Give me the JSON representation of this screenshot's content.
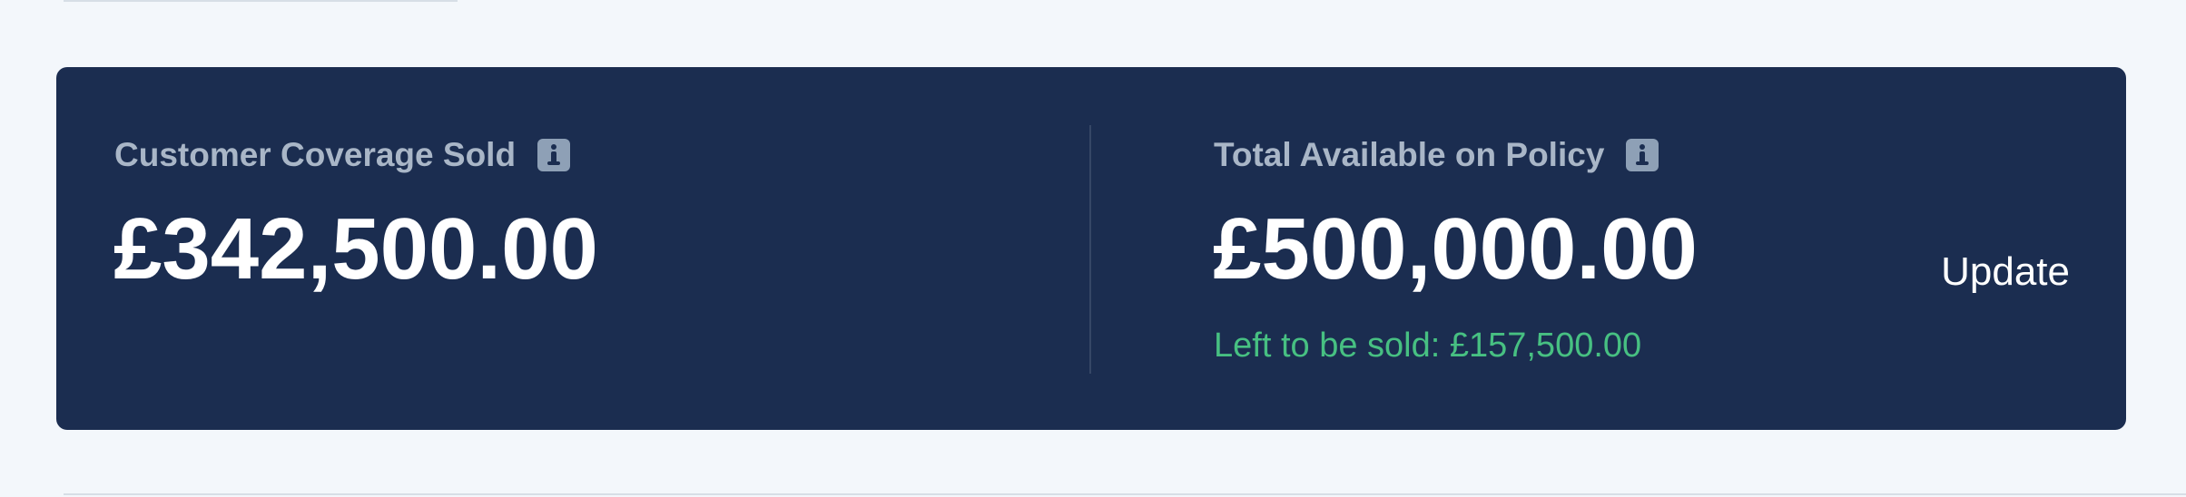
{
  "coverage_sold": {
    "label": "Customer Coverage Sold",
    "value": "£342,500.00",
    "icon": "info-icon"
  },
  "total_available": {
    "label": "Total Available on Policy",
    "value": "£500,000.00",
    "icon": "info-icon",
    "left_to_be_sold": "Left to be sold: £157,500.00"
  },
  "actions": {
    "update_label": "Update"
  },
  "colors": {
    "card_background": "#1b2d50",
    "page_background": "#f3f7fb",
    "label_text": "#a9b6c7",
    "value_text": "#ffffff",
    "positive_text": "#47c082",
    "info_icon_background": "#8ea0b6"
  }
}
